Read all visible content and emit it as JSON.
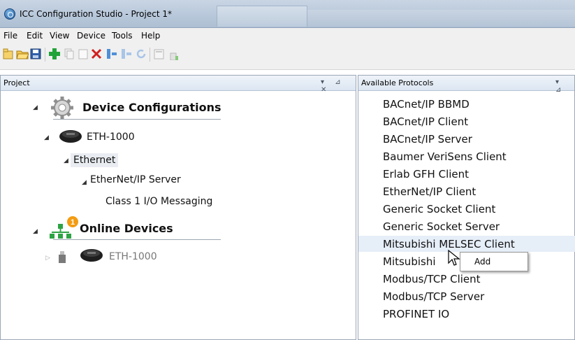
{
  "window": {
    "title": "ICC Configuration Studio - Project 1*"
  },
  "menu": [
    "File",
    "Edit",
    "View",
    "Device",
    "Tools",
    "Help"
  ],
  "project_panel": {
    "title": "Project",
    "tree": {
      "device_configurations": "Device Configurations",
      "device": "ETH-1000",
      "ethernet": "Ethernet",
      "ethernetip_server": "EtherNet/IP Server",
      "class1_messaging": "Class 1 I/O Messaging",
      "online_devices": "Online Devices",
      "online_badge": "1",
      "online_device": "ETH-1000"
    }
  },
  "protocol_panel": {
    "title": "Available Protocols",
    "items": [
      "BACnet/IP BBMD",
      "BACnet/IP Client",
      "BACnet/IP Server",
      "Baumer VeriSens Client",
      "Erlab GFH Client",
      "EtherNet/IP Client",
      "Generic Socket Client",
      "Generic Socket Server",
      "Mitsubishi MELSEC Client",
      "Mitsubishi",
      "Modbus/TCP Client",
      "Modbus/TCP Server",
      "PROFINET IO"
    ]
  },
  "context_menu": {
    "add": "Add"
  },
  "colors": {
    "accent_blue": "#1e5a9c",
    "add_green": "#22a33a",
    "delete_red": "#d21f1f",
    "badge_orange": "#f39c12"
  }
}
